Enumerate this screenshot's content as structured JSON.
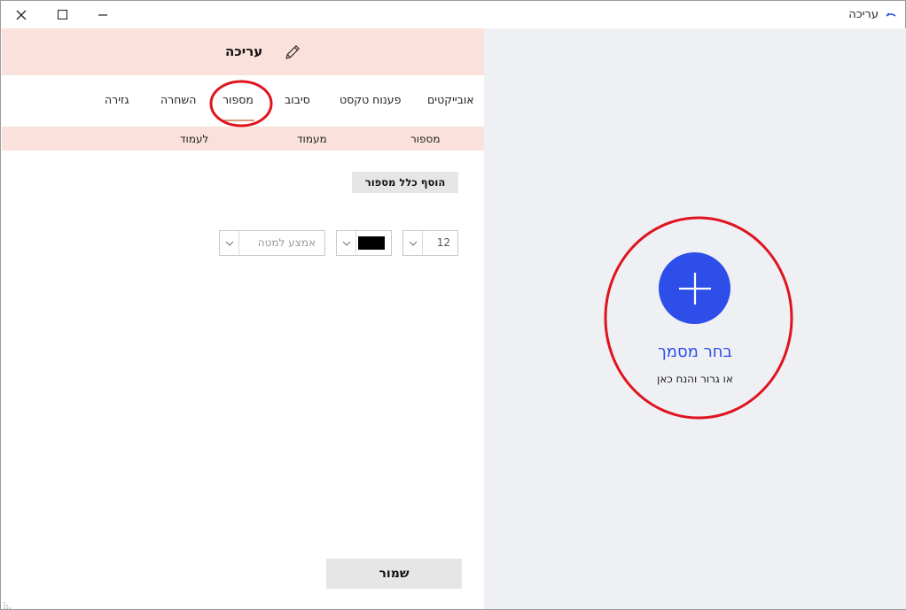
{
  "window": {
    "title": "עריכה"
  },
  "editor": {
    "header_title": "עריכה",
    "tabs": [
      {
        "label": "אובייקטים"
      },
      {
        "label": "פענוח טקסט"
      },
      {
        "label": "סיבוב"
      },
      {
        "label": "מספור"
      },
      {
        "label": "השחרה"
      },
      {
        "label": "גזירה"
      }
    ],
    "active_tab": "מספור",
    "columns": {
      "number": "מספור",
      "from_page": "מעמוד",
      "to_page": "לעמוד"
    },
    "add_rule_label": "הוסף כלל מספור",
    "font_size_value": "12",
    "font_color": "#000000",
    "position_placeholder": "אמצע למטה",
    "save_label": "שמור"
  },
  "drop_zone": {
    "choose_label": "בחר מסמך",
    "drag_hint": "או גרור והנח כאן"
  },
  "colors": {
    "header_bg": "#fbe1db",
    "accent_blue": "#2d4ee8",
    "drop_bg": "#eef0f4",
    "annotation_red": "#e0141e"
  }
}
